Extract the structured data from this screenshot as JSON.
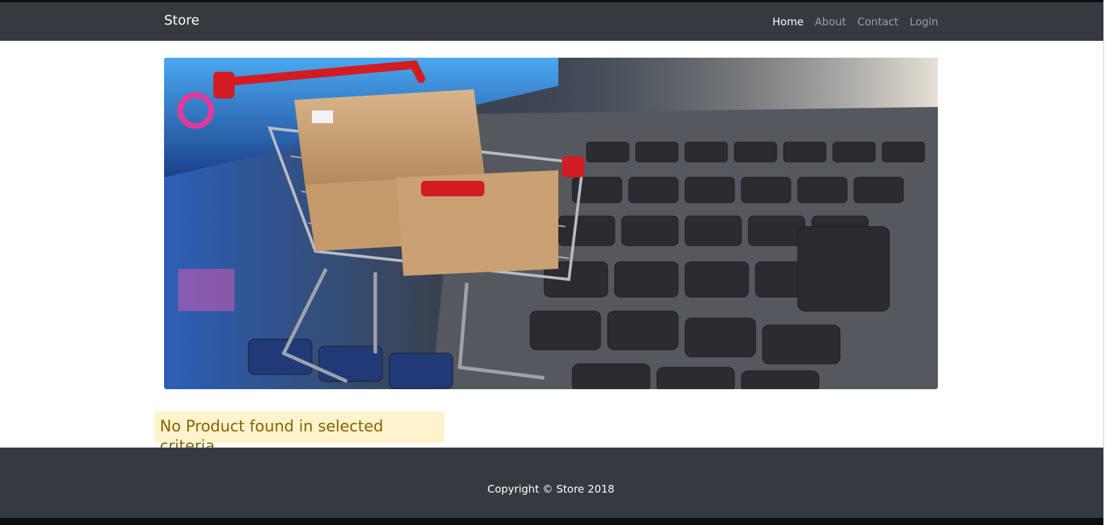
{
  "navbar": {
    "brand": "Store",
    "links": [
      {
        "label": "Home",
        "active": true
      },
      {
        "label": "About",
        "active": false
      },
      {
        "label": "Contact",
        "active": false
      },
      {
        "label": "Login",
        "active": false
      }
    ]
  },
  "hero": {
    "image": "shopping-cart-with-boxes-on-laptop-keyboard"
  },
  "alert": {
    "message": "No Product found in selected criteria",
    "background": "#fff3cd",
    "color": "#856404"
  },
  "footer": {
    "copyright": "Copyright © Store 2018"
  },
  "colors": {
    "navbar_bg": "#343a40",
    "footer_bg": "#343a40"
  }
}
